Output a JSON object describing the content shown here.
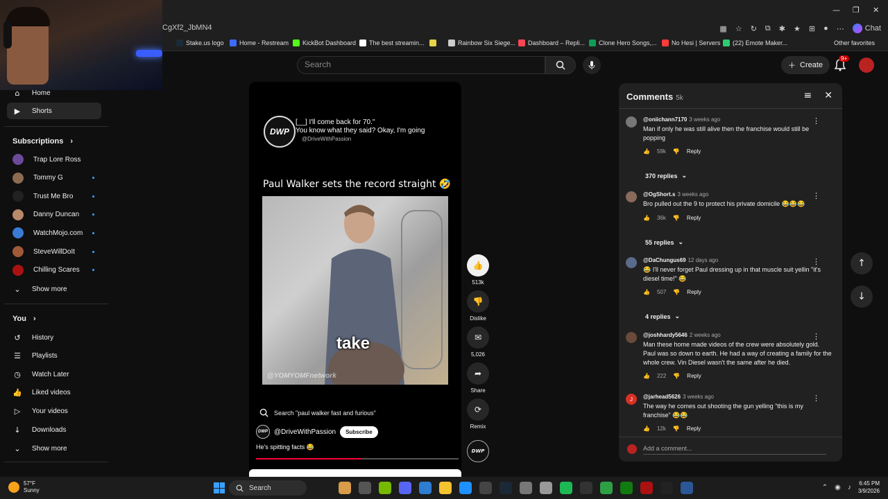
{
  "browser": {
    "address": "CgXf2_JbMN4",
    "chat_label": "Chat",
    "bookmarks": [
      {
        "label": "Stake.us logo",
        "color": "#1a2c38"
      },
      {
        "label": "Home - Restream",
        "color": "#3d6bff"
      },
      {
        "label": "KickBot Dashboard",
        "color": "#53fc18"
      },
      {
        "label": "The best streamin...",
        "color": "#ffffff"
      },
      {
        "label": "",
        "color": "#e8d24a"
      },
      {
        "label": "Rainbow Six Siege...",
        "color": "#cccccc"
      },
      {
        "label": "Dashboard – Repli...",
        "color": "#ff4655"
      },
      {
        "label": "Clone Hero Songs,...",
        "color": "#0f9d58"
      },
      {
        "label": "No Hesi | Servers",
        "color": "#ff3b3b"
      },
      {
        "label": "(22) Emote Maker...",
        "color": "#2ecc71"
      }
    ],
    "other_favorites": "Other favorites"
  },
  "header": {
    "search_placeholder": "Search",
    "create_label": "Create",
    "notif_count": "9+"
  },
  "sidebar": {
    "top": [
      {
        "label": "Home",
        "icon": "home-icon",
        "glyph": "⌂"
      },
      {
        "label": "Shorts",
        "icon": "shorts-icon",
        "glyph": "▶",
        "active": true
      }
    ],
    "subscriptions_title": "Subscriptions",
    "subscriptions": [
      {
        "label": "Trap Lore Ross",
        "color": "#6b4a9a",
        "dot": false
      },
      {
        "label": "Tommy G",
        "color": "#8c6b50",
        "dot": true
      },
      {
        "label": "Trust Me Bro",
        "color": "#222222",
        "dot": true
      },
      {
        "label": "Danny Duncan",
        "color": "#b88a6a",
        "dot": true
      },
      {
        "label": "WatchMojo.com",
        "color": "#3a7bd5",
        "dot": true
      },
      {
        "label": "SteveWillDoIt",
        "color": "#a05a3a",
        "dot": true
      },
      {
        "label": "Chilling Scares",
        "color": "#aa1111",
        "dot": true
      }
    ],
    "show_more": "Show more",
    "you_title": "You",
    "you_items": [
      {
        "label": "History",
        "glyph": "↺",
        "icon": "history-icon"
      },
      {
        "label": "Playlists",
        "glyph": "☰",
        "icon": "playlists-icon"
      },
      {
        "label": "Watch Later",
        "glyph": "◷",
        "icon": "watch-later-icon"
      },
      {
        "label": "Liked videos",
        "glyph": "👍",
        "icon": "liked-icon"
      },
      {
        "label": "Your videos",
        "glyph": "▷",
        "icon": "your-videos-icon"
      },
      {
        "label": "Downloads",
        "glyph": "↓",
        "icon": "downloads-icon"
      }
    ],
    "show_more_2": "Show more"
  },
  "short": {
    "overlay_line1": "[__] I'll come back for 70.\"",
    "overlay_line2": "You know what they said? Okay, I'm going",
    "overlay_handle": "@DriveWithPassion",
    "logo_text": "DWP",
    "title": "Paul Walker sets the record straight 🤣",
    "caption": "take",
    "watermark": "@YOMYOMFnetwork",
    "search_suggest": "Search \"paul walker fast and furious\"",
    "channel": "@DriveWithPassion",
    "subscribe": "Subscribe",
    "description": "He's spitting facts 😂",
    "progress": 0.52
  },
  "actions": {
    "likes": "513k",
    "dislike": "Dislike",
    "comments": "5,026",
    "share": "Share",
    "remix": "Remix"
  },
  "comments": {
    "title": "Comments",
    "count": "5k",
    "add_placeholder": "Add a comment...",
    "items": [
      {
        "user": "@oniichann7170",
        "time": "3 weeks ago",
        "text": "Man if only he was still alive then the franchise would still be popping",
        "likes": "59k",
        "replies": "370 replies",
        "color": "#777777"
      },
      {
        "user": "@OgShort.s",
        "time": "3 weeks ago",
        "text": "Bro pulled out the 9 to protect his private domicile 😂😂😂",
        "likes": "36k",
        "replies": "55 replies",
        "color": "#8a6a5a"
      },
      {
        "user": "@DaChungus69",
        "time": "12 days ago",
        "text": "😂 I'll never forget Paul dressing up in that muscle suit yellin \"it's diesel time!\" 😂",
        "likes": "507",
        "replies": "4 replies",
        "color": "#5a6a8a"
      },
      {
        "user": "@joshhardy5646",
        "time": "2 weeks ago",
        "text": "Man these home made videos of the crew were absolutely gold. Paul was so down to earth. He had a way of creating a family for the whole crew. Vin Diesel wasn't the same after he died.",
        "likes": "222",
        "replies": "",
        "color": "#6a4a3a"
      },
      {
        "user": "@jarhead5626",
        "time": "3 weeks ago",
        "text": "The way he comes out shooting the gun yelling \"this is my franchise\" 😂😂",
        "likes": "12k",
        "replies": "",
        "color": "#d93025",
        "initial": "J"
      }
    ],
    "reply_label": "Reply"
  },
  "taskbar": {
    "temp": "57°F",
    "weather": "Sunny",
    "search": "Search",
    "time": "6:45 PM",
    "date": "3/9/2026"
  }
}
